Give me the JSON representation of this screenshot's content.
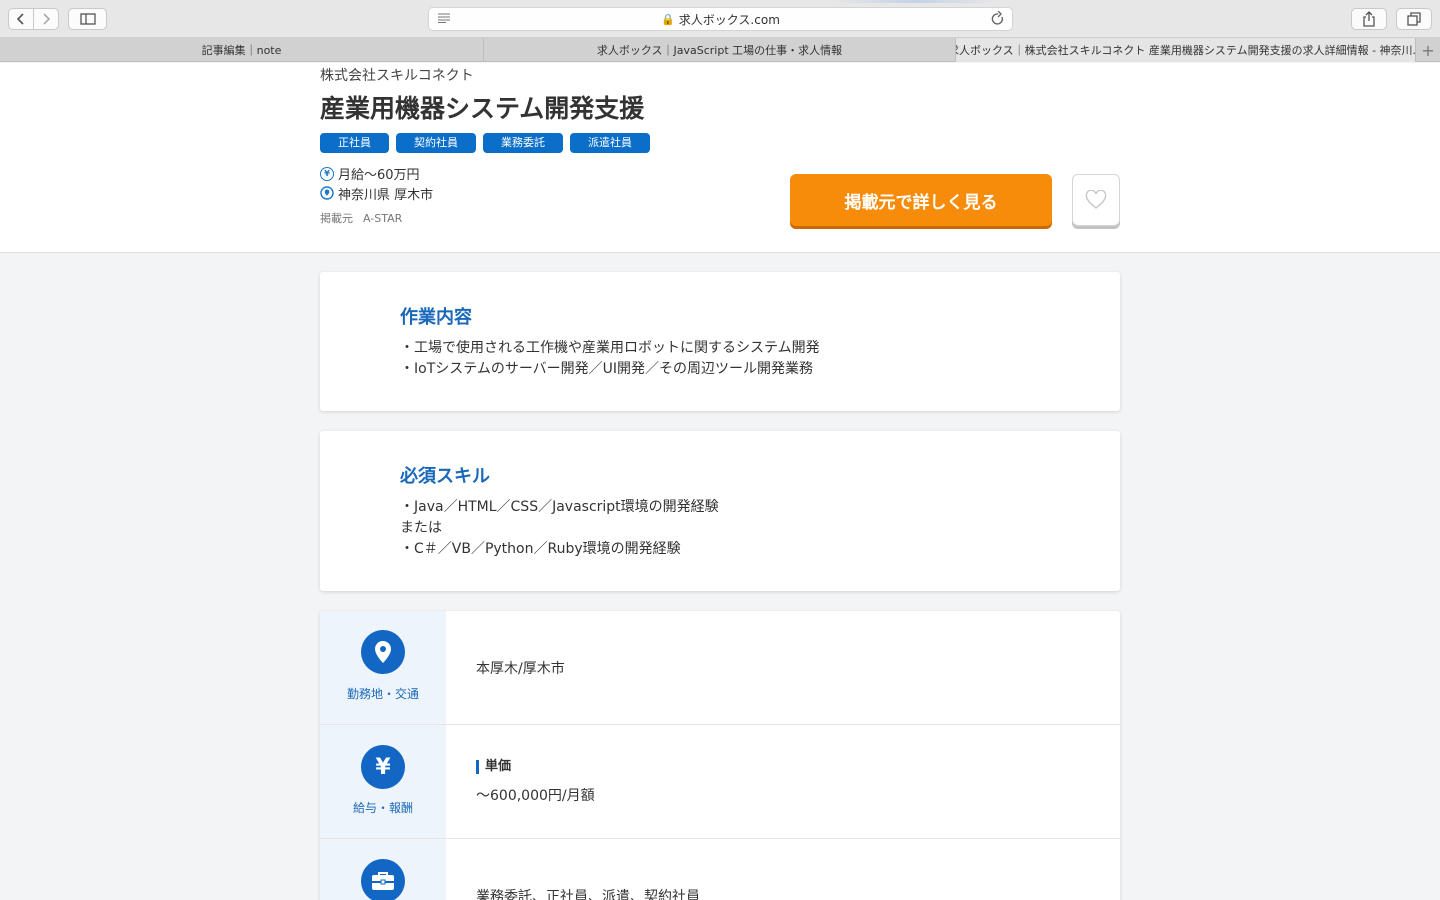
{
  "browser": {
    "url": "求人ボックス.com",
    "tabs": [
      {
        "label": "記事編集｜note"
      },
      {
        "label": "求人ボックス｜JavaScript 工場の仕事・求人情報"
      },
      {
        "label": "求人ボックス｜株式会社スキルコネクト 産業用機器システム開発支援の求人詳細情報 - 神奈川..."
      }
    ]
  },
  "job": {
    "company": "株式会社スキルコネクト",
    "title": "産業用機器システム開発支援",
    "tags": [
      "正社員",
      "契約社員",
      "業務委託",
      "派遣社員"
    ],
    "salary": "月給〜60万円",
    "location": "神奈川県 厚木市",
    "source_label": "掲載元",
    "source_name": "A-STAR",
    "cta_label": "掲載元で詳しく見る"
  },
  "sections": {
    "work": {
      "heading": "作業内容",
      "lines": [
        "・工場で使用される工作機や産業用ロボットに関するシステム開発",
        "・IoTシステムのサーバー開発／UI開発／その周辺ツール開発業務"
      ]
    },
    "skills": {
      "heading": "必須スキル",
      "lines": [
        "・Java／HTML／CSS／Javascript環境の開発経験",
        "または",
        "・C＃／VB／Python／Ruby環境の開発経験"
      ]
    }
  },
  "details": {
    "location": {
      "label": "勤務地・交通",
      "value": "本厚木/厚木市"
    },
    "salary": {
      "label": "給与・報酬",
      "subhead": "単価",
      "value": "〜600,000円/月額"
    },
    "employment": {
      "value": "業務委託、正社員、派遣、契約社員"
    }
  },
  "colors": {
    "accent": "#1266c4",
    "cta": "#f68c0a"
  }
}
